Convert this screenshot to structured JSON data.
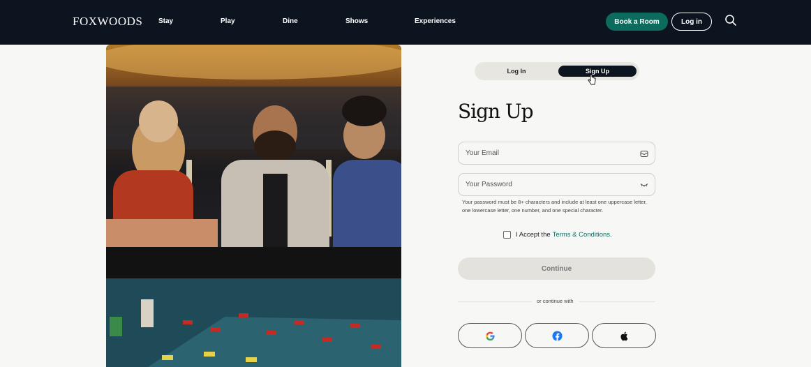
{
  "header": {
    "logo": "FOXWOODS",
    "nav": [
      "Stay",
      "Play",
      "Dine",
      "Shows",
      "Experiences"
    ],
    "book_label": "Book a Room",
    "login_label": "Log in"
  },
  "auth": {
    "tabs": {
      "login": "Log In",
      "signup": "Sign Up"
    },
    "title": "Sign Up",
    "email_placeholder": "Your Email",
    "password_placeholder": "Your Password",
    "password_hint": "Your password must be 8+ characters and include at least one uppercase letter, one lowercase letter, one number, and one special character.",
    "accept_prefix": "I Accept the",
    "terms_link": "Terms & Conditions",
    "accept_suffix": ".",
    "continue_label": "Continue",
    "divider_text": "or continue with"
  },
  "colors": {
    "nav_bg": "#0c1420",
    "accent": "#0d6b5d",
    "page_bg": "#f7f7f6"
  },
  "icons": {
    "search": "search-icon",
    "email": "mail-icon",
    "password": "eye-closed-icon",
    "social": [
      "google-icon",
      "facebook-icon",
      "apple-icon"
    ]
  }
}
